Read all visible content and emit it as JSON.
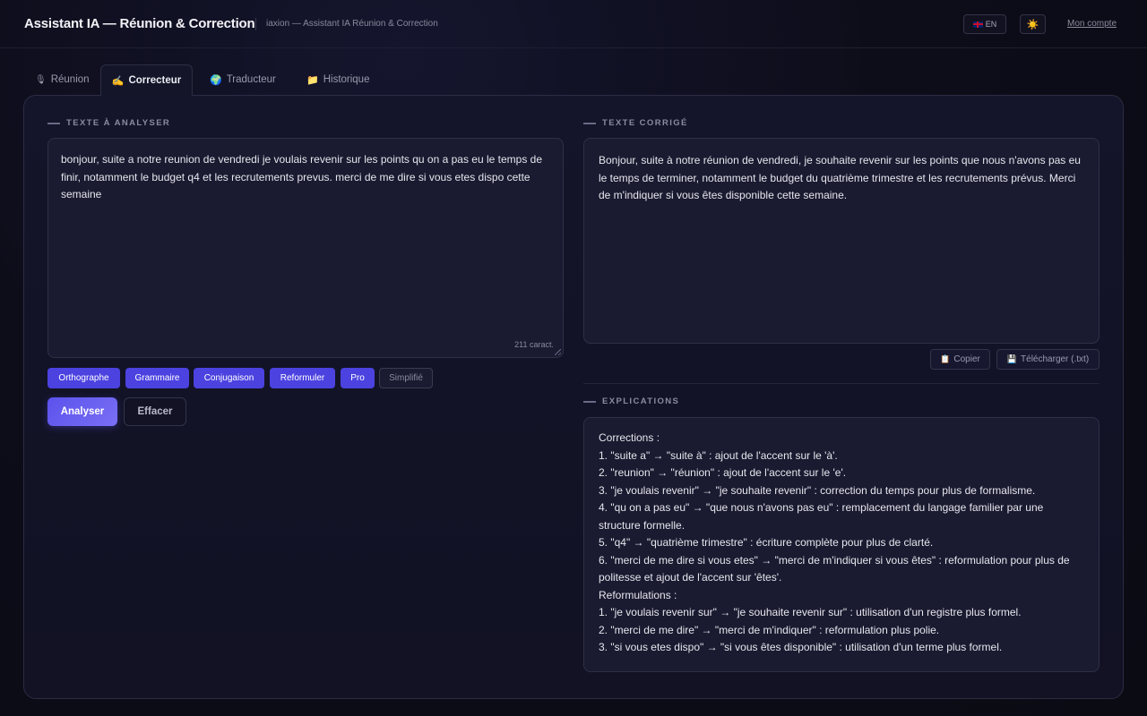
{
  "header": {
    "title": "Assistant IA — Réunion & Correction",
    "subtitle": "iaxion — Assistant IA Réunion & Correction",
    "lang_label": "EN",
    "theme_icon": "☀️",
    "account_label": "Mon compte"
  },
  "tabs": [
    {
      "icon": "🎙",
      "label": "Réunion"
    },
    {
      "icon": "✍️",
      "label": "Correcteur"
    },
    {
      "icon": "🌍",
      "label": "Traducteur"
    },
    {
      "icon": "📁",
      "label": "Historique"
    }
  ],
  "input": {
    "label": "TEXTE À ANALYSER",
    "text": "bonjour, suite a notre reunion de vendredi je voulais revenir sur les points qu on a pas eu le temps de finir, notamment le budget q4 et les recrutements prevus. merci de me dire si vous etes dispo cette semaine",
    "char_count": "211 caract."
  },
  "modes": [
    {
      "label": "Orthographe",
      "active": true
    },
    {
      "label": "Grammaire",
      "active": true
    },
    {
      "label": "Conjugaison",
      "active": true
    },
    {
      "label": "Reformuler",
      "active": true
    },
    {
      "label": "Pro",
      "active": true
    },
    {
      "label": "Simplifié",
      "active": false
    }
  ],
  "actions": {
    "analyse": "Analyser",
    "clear": "Effacer"
  },
  "output": {
    "label": "TEXTE CORRIGÉ",
    "text": "Bonjour, suite à notre réunion de vendredi, je souhaite revenir sur les points que nous n'avons pas eu le temps de terminer, notamment le budget du quatrième trimestre et les recrutements prévus. Merci de m'indiquer si vous êtes disponible cette semaine.",
    "copy_label": "Copier",
    "copy_icon": "📋",
    "download_label": "Télécharger (.txt)",
    "download_icon": "💾"
  },
  "explanations": {
    "label": "EXPLICATIONS",
    "lines": [
      "Corrections :",
      "1. \"suite a\" → \"suite à\" : ajout de l'accent sur le 'à'.",
      "2. \"reunion\" → \"réunion\" : ajout de l'accent sur le 'e'.",
      "3. \"je voulais revenir\" → \"je souhaite revenir\" : correction du temps pour plus de formalisme.",
      "4. \"qu on a pas eu\" → \"que nous n'avons pas eu\" : remplacement du langage familier par une structure formelle.",
      "5. \"q4\" → \"quatrième trimestre\" : écriture complète pour plus de clarté.",
      "6. \"merci de me dire si vous etes\" → \"merci de m'indiquer si vous êtes\" : reformulation pour plus de politesse et ajout de l'accent sur 'êtes'.",
      "Reformulations :",
      "1. \"je voulais revenir sur\" → \"je souhaite revenir sur\" : utilisation d'un registre plus formel.",
      "2. \"merci de me dire\" → \"merci de m'indiquer\" : reformulation plus polie.",
      "3. \"si vous etes dispo\" → \"si vous êtes disponible\" : utilisation d'un terme plus formel."
    ]
  }
}
